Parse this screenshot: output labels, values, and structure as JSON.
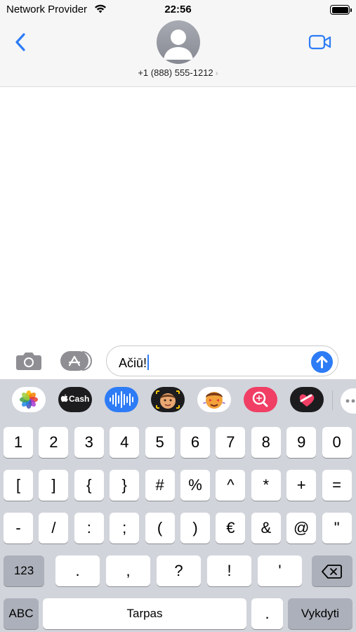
{
  "status_bar": {
    "carrier": "Network Provider",
    "time": "22:56"
  },
  "header": {
    "contact": "+1 (888) 555-1212",
    "chevron": "›"
  },
  "composer": {
    "text": "Ačiū!"
  },
  "app_strip": [
    {
      "name": "photos",
      "label": ""
    },
    {
      "name": "apple-cash",
      "label": "Cash"
    },
    {
      "name": "audio-message",
      "label": ""
    },
    {
      "name": "memoji",
      "label": ""
    },
    {
      "name": "memoji-stickers",
      "label": ""
    },
    {
      "name": "image-search",
      "label": ""
    },
    {
      "name": "digital-touch",
      "label": ""
    }
  ],
  "keyboard": {
    "row1": [
      "1",
      "2",
      "3",
      "4",
      "5",
      "6",
      "7",
      "8",
      "9",
      "0"
    ],
    "row2": [
      "[",
      "]",
      "{",
      "}",
      "#",
      "%",
      "^",
      "*",
      "+",
      "="
    ],
    "row3": [
      "-",
      "/",
      ":",
      ";",
      "(",
      ")",
      "€",
      "&",
      "@",
      "\""
    ],
    "row4": [
      ".",
      ",",
      "?",
      "!",
      "'"
    ],
    "mode_key": "123",
    "abc_key": "ABC",
    "space_key": "Tarpas",
    "period_key": ".",
    "return_key": "Vykdyti"
  }
}
